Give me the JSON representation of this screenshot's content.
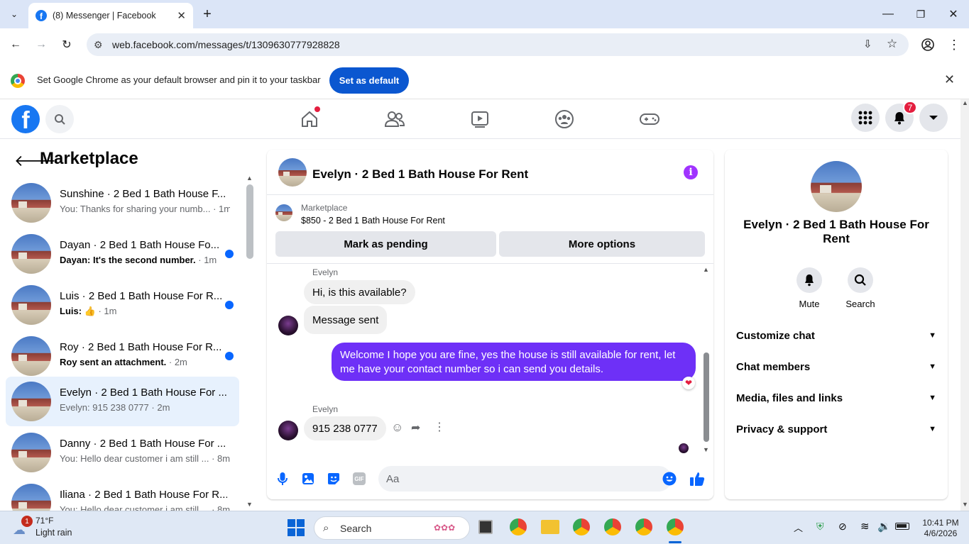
{
  "browser": {
    "tab_title": "(8) Messenger | Facebook",
    "url": "web.facebook.com/messages/t/1309630777928828",
    "infobar_text": "Set Google Chrome as your default browser and pin it to your taskbar",
    "infobar_button": "Set as default"
  },
  "header": {
    "notif_count": "7"
  },
  "sidebar": {
    "title": "Marketplace",
    "conversations": [
      {
        "name": "Sunshine · 2 Bed 1 Bath House F...",
        "preview": "You: Thanks for sharing your numb...",
        "time": " · 1m",
        "unread": false
      },
      {
        "name": "Dayan · 2 Bed 1 Bath House Fo...",
        "preview": "Dayan: It's the second number.",
        "time": " · 1m",
        "unread": true
      },
      {
        "name": "Luis · 2 Bed 1 Bath House For R...",
        "preview": "Luis: 👍",
        "time": " · 1m",
        "unread": true
      },
      {
        "name": "Roy · 2 Bed 1 Bath House For R...",
        "preview": "Roy sent an attachment.",
        "time": " · 2m",
        "unread": true
      },
      {
        "name": "Evelyn · 2 Bed 1 Bath House For ...",
        "preview": "Evelyn: 915 238 0777",
        "time": " · 2m",
        "unread": false
      },
      {
        "name": "Danny · 2 Bed 1 Bath House For ...",
        "preview": "You: Hello dear customer i am still ...",
        "time": " · 8m",
        "unread": false
      },
      {
        "name": "Iliana · 2 Bed 1 Bath House For R...",
        "preview": "You: Hello dear customer i am still ...",
        "time": " · 8m",
        "unread": false
      }
    ]
  },
  "chat": {
    "title": "Evelyn · 2 Bed 1 Bath House For Rent",
    "listing_category": "Marketplace",
    "listing_price": "$850 - 2 Bed 1 Bath House For Rent",
    "btn_pending": "Mark as pending",
    "btn_more": "More options",
    "sender1": "Evelyn",
    "msg1": "Hi, is this available?",
    "msg2": "Message sent",
    "msg_out": "Welcome I hope you are fine, yes the house is still available for rent, let me have your contact number so i can send you  details.",
    "sender2": "Evelyn",
    "msg3": "915 238 0777",
    "input_placeholder": "Aa"
  },
  "details": {
    "name": "Evelyn · 2 Bed 1 Bath House For Rent",
    "mute": "Mute",
    "search": "Search",
    "rows": [
      "Customize chat",
      "Chat members",
      "Media, files and links",
      "Privacy & support"
    ]
  },
  "taskbar": {
    "temp": "71°F",
    "weather": "Light rain",
    "weather_badge": "1",
    "search": "Search",
    "time": "10:41 PM",
    "date": "4/6/2026"
  },
  "colors": {
    "fb_blue": "#1877f2",
    "outgoing_bubble": "#6e30f7",
    "unread_dot": "#0866ff"
  }
}
